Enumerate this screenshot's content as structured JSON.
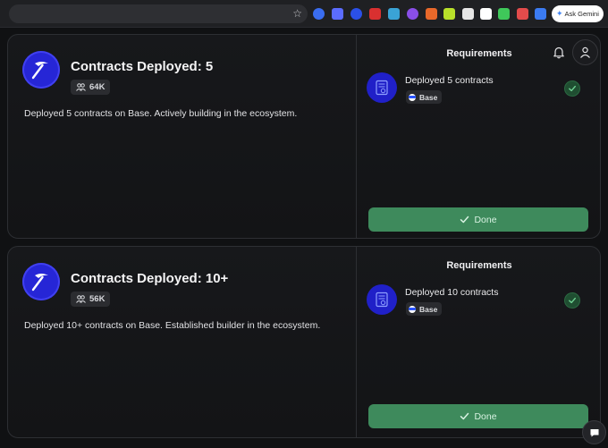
{
  "browser": {
    "ask_gemini_label": "Ask Gemini",
    "extensions": [
      {
        "icon": "extension-blue-icon",
        "color": "#3a6df0"
      },
      {
        "icon": "extension-cloud-icon",
        "color": "#5b6cff"
      },
      {
        "icon": "extension-shield-icon",
        "color": "#2b50e8"
      },
      {
        "icon": "extension-lock-icon",
        "color": "#d93030"
      },
      {
        "icon": "extension-scan-icon",
        "color": "#3aa3d6"
      },
      {
        "icon": "extension-circle-icon",
        "color": "#8a4ee8"
      },
      {
        "icon": "extension-fox-icon",
        "color": "#e8682a"
      },
      {
        "icon": "extension-lime-icon",
        "color": "#b8e02a"
      },
      {
        "icon": "extension-s-icon",
        "color": "#e6e6e6"
      },
      {
        "icon": "extension-m-icon",
        "color": "#ffffff"
      },
      {
        "icon": "extension-green-icon",
        "color": "#3fc85a"
      },
      {
        "icon": "extension-red-icon",
        "color": "#e24b4b"
      },
      {
        "icon": "extension-translate-icon",
        "color": "#3b7bf2"
      }
    ]
  },
  "cards": [
    {
      "title": "Contracts Deployed: 5",
      "holders": "64K",
      "description": "Deployed 5 contracts on Base. Actively building in the ecosystem.",
      "requirements_title": "Requirements",
      "requirement": "Deployed 5 contracts",
      "chain": "Base",
      "status_label": "Done"
    },
    {
      "title": "Contracts Deployed: 10+",
      "holders": "56K",
      "description": "Deployed 10+ contracts on Base. Established builder in the ecosystem.",
      "requirements_title": "Requirements",
      "requirement": "Deployed 10 contracts",
      "chain": "Base",
      "status_label": "Done"
    }
  ],
  "colors": {
    "badge_blue": "#2626d6",
    "done_green": "#3e8a5c",
    "check_green": "#1f4e31"
  }
}
